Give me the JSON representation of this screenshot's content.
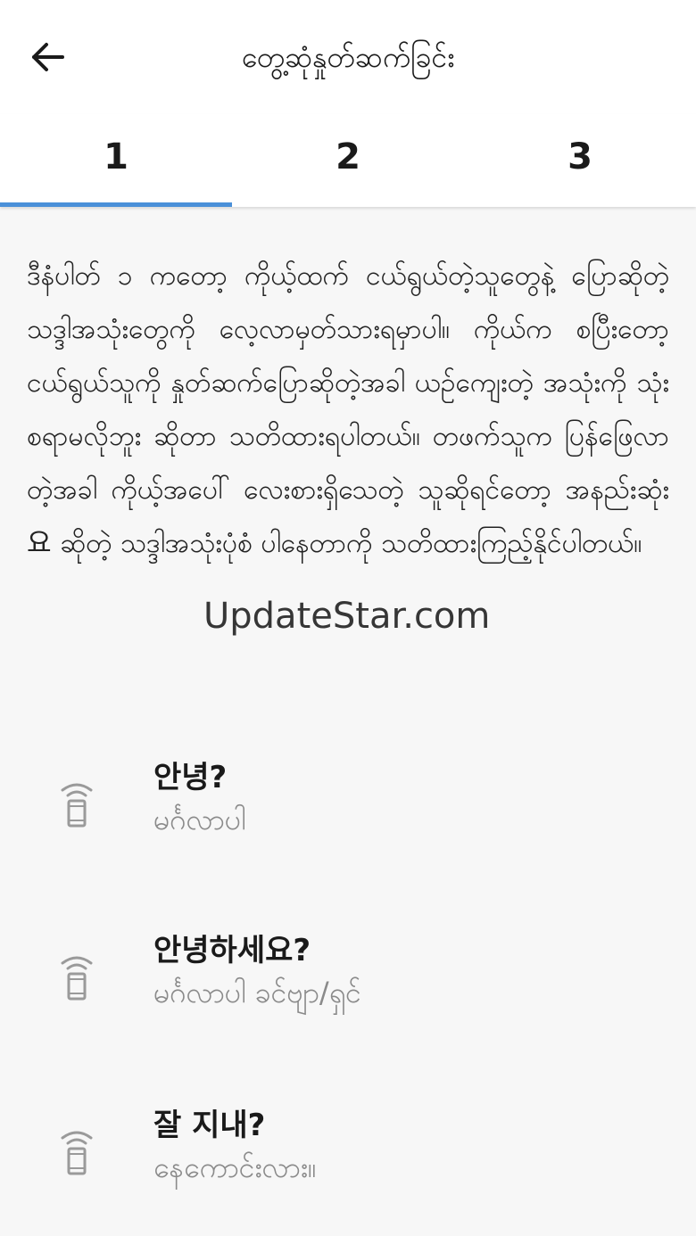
{
  "header": {
    "title": "တွေ့ဆုံနှုတ်ဆက်ခြင်း",
    "back_icon": "arrow-left-icon"
  },
  "tabs": [
    {
      "label": "1",
      "active": true
    },
    {
      "label": "2",
      "active": false
    },
    {
      "label": "3",
      "active": false
    }
  ],
  "colors": {
    "accent": "#4a90d9",
    "background": "#f7f7f7",
    "secondary_text": "#8a8a8a"
  },
  "intro": {
    "text": "ဒီနံပါတ် ၁ ကတော့ ကိုယ့်ထက် ငယ်ရွယ်တဲ့သူတွေနဲ့ ပြောဆိုတဲ့ သဒ္ဒါအသုံးတွေကို လေ့လာမှတ်သားရမှာပါ။ ကိုယ်က စပြီးတော့ ငယ်ရွယ်သူကို နှုတ်ဆက်ပြောဆိုတဲ့အခါ ယဉ်ကျေးတဲ့ အသုံးကို သုံးစရာမလိုဘူး ဆိုတာ သတိထားရပါတယ်။ တဖက်သူက ပြန်ဖြေလာတဲ့အခါ ကိုယ့်အပေါ် လေးစားရှိသေတဲ့ သူဆိုရင်တော့ အနည်းဆုံး 요 ဆိုတဲ့ သဒ္ဒါအသုံးပုံစံ ပါနေတာကို သတိထားကြည့်နိုင်ပါတယ်။"
  },
  "watermark": "UpdateStar.com",
  "phrases": [
    {
      "korean": "안녕?",
      "burmese": "မင်္ဂလာပါ",
      "icon": "speaker-icon"
    },
    {
      "korean": "안녕하세요?",
      "burmese": "မင်္ဂလာပါ ခင်ဗျာ/ရှင်",
      "icon": "speaker-icon"
    },
    {
      "korean": "잘 지내?",
      "burmese": "နေကောင်းလား။",
      "icon": "speaker-icon"
    }
  ]
}
